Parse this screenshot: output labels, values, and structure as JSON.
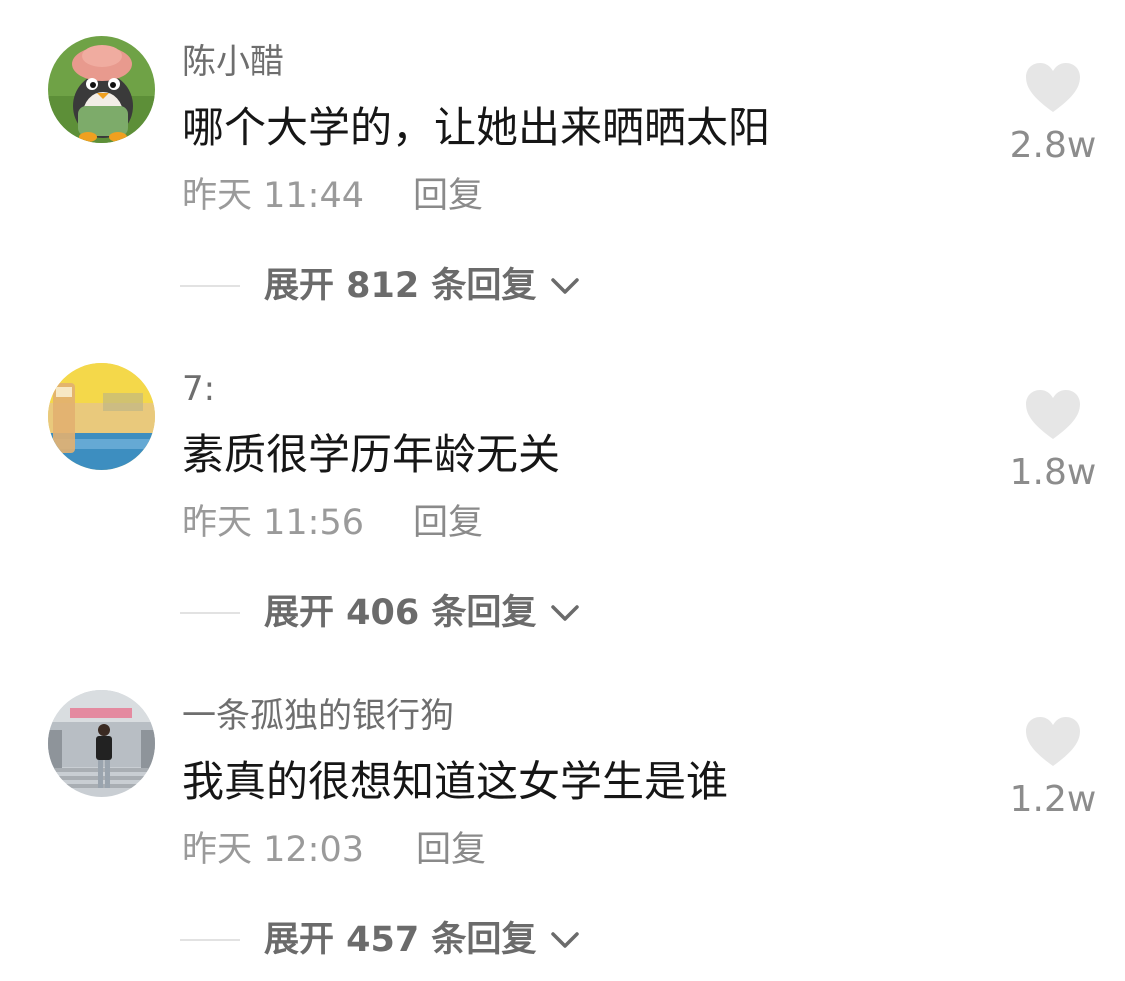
{
  "comments": [
    {
      "username": "陈小醋",
      "text": "哪个大学的，让她出来晒晒太阳",
      "time": "昨天 11:44",
      "reply_label": "回复",
      "likes": "2.8w",
      "expand_label": "展开 812 条回复",
      "avatar_icon": "penguin-plush-avatar"
    },
    {
      "username": "7:",
      "text": "素质很学历年龄无关",
      "time": "昨天 11:56",
      "reply_label": "回复",
      "likes": "1.8w",
      "expand_label": "展开 406 条回复",
      "avatar_icon": "blurred-photo-avatar"
    },
    {
      "username": "一条孤独的银行狗",
      "text": "我真的很想知道这女学生是谁",
      "time": "昨天 12:03",
      "reply_label": "回复",
      "likes": "1.2w",
      "expand_label": "展开 457 条回复",
      "avatar_icon": "person-photo-avatar"
    }
  ],
  "colors": {
    "username": "#6e6e6e",
    "text": "#161616",
    "meta": "#9a9a9a",
    "heart": "#e6e6e6",
    "expand": "#6b6b6b"
  }
}
